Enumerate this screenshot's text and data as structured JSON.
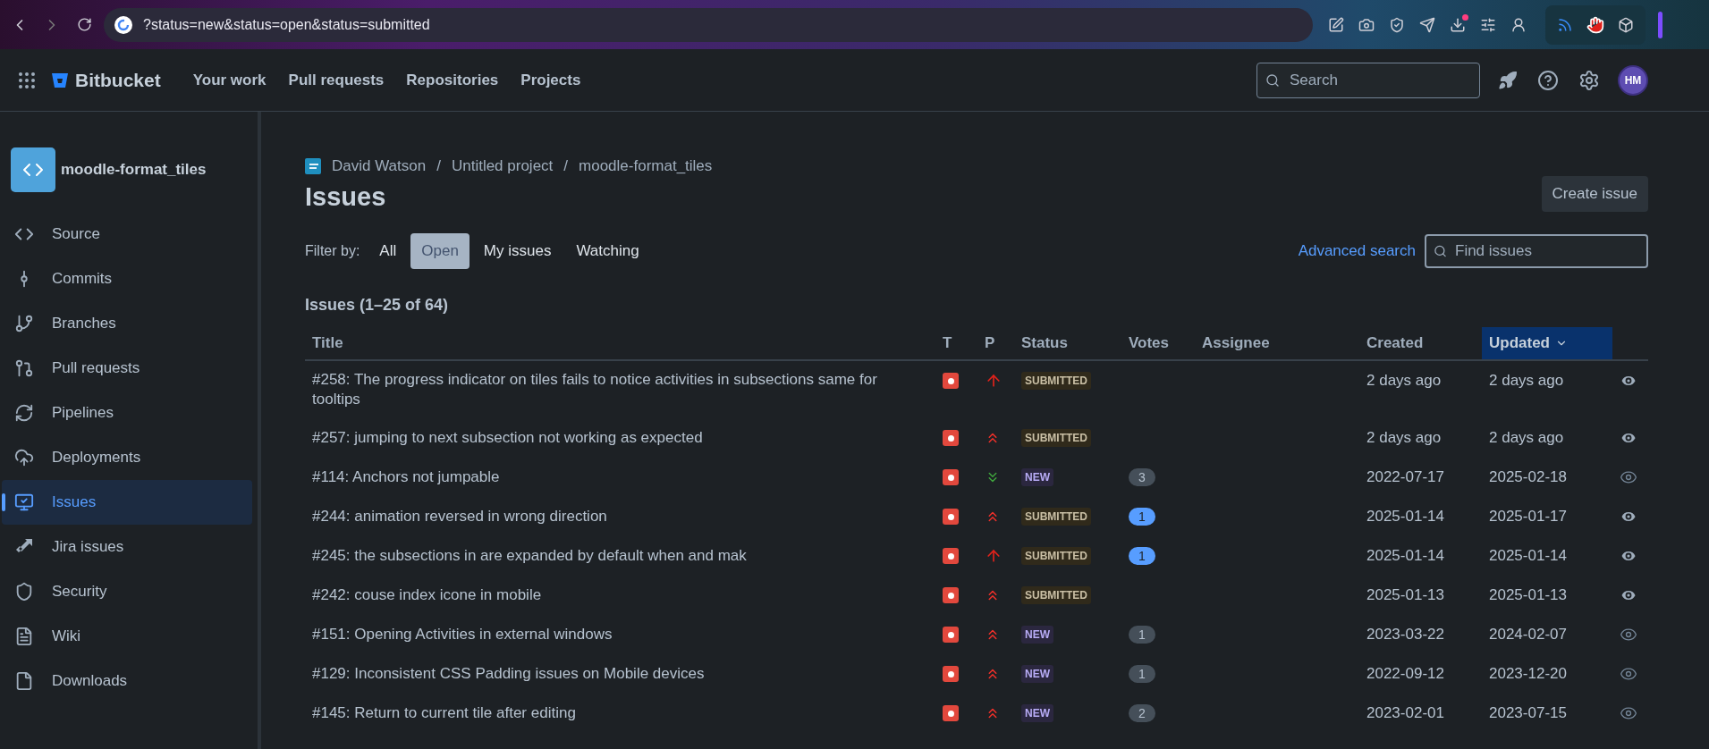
{
  "browser": {
    "url": "?status=new&status=open&status=submitted"
  },
  "nav": {
    "brand": "Bitbucket",
    "links": [
      "Your work",
      "Pull requests",
      "Repositories",
      "Projects"
    ],
    "search": {
      "placeholder": "Search"
    },
    "avatar": "HM"
  },
  "sidebar": {
    "repo": "moodle-format_tiles",
    "items": [
      {
        "label": "Source",
        "selected": false
      },
      {
        "label": "Commits",
        "selected": false
      },
      {
        "label": "Branches",
        "selected": false
      },
      {
        "label": "Pull requests",
        "selected": false
      },
      {
        "label": "Pipelines",
        "selected": false
      },
      {
        "label": "Deployments",
        "selected": false
      },
      {
        "label": "Issues",
        "selected": true
      },
      {
        "label": "Jira issues",
        "selected": false
      },
      {
        "label": "Security",
        "selected": false
      },
      {
        "label": "Wiki",
        "selected": false
      },
      {
        "label": "Downloads",
        "selected": false
      }
    ]
  },
  "breadcrumbs": {
    "items": [
      "David Watson",
      "Untitled project",
      "moodle-format_tiles"
    ],
    "separators": [
      "/",
      "/"
    ]
  },
  "title": "Issues",
  "create_button": "Create issue",
  "filter": {
    "label": "Filter by:",
    "options": [
      {
        "label": "All",
        "selected": false
      },
      {
        "label": "Open",
        "selected": true
      },
      {
        "label": "My issues",
        "selected": false
      },
      {
        "label": "Watching",
        "selected": false
      }
    ],
    "advanced": "Advanced search",
    "find": {
      "placeholder": "Find issues"
    }
  },
  "count": "Issues (1–25 of 64)",
  "table": {
    "columns": [
      {
        "label": "Title",
        "sorted": false
      },
      {
        "label": "T",
        "sorted": false
      },
      {
        "label": "P",
        "sorted": false
      },
      {
        "label": "Status",
        "sorted": false
      },
      {
        "label": "Votes",
        "sorted": false
      },
      {
        "label": "Assignee",
        "sorted": false
      },
      {
        "label": "Created",
        "sorted": false
      },
      {
        "label": "Updated",
        "sorted": true
      }
    ],
    "rows": [
      {
        "title": "#258: The progress indicator on tiles fails to notice activities in subsections same for tooltips",
        "priority": {
          "kind": "critical"
        },
        "status": {
          "label": "SUBMITTED",
          "kind": "submitted"
        },
        "created": "2 days ago",
        "updated": "2 days ago",
        "watching": true
      },
      {
        "title": "#257: jumping to next subsection not working as expected",
        "priority": {
          "kind": "major"
        },
        "status": {
          "label": "SUBMITTED",
          "kind": "submitted"
        },
        "created": "2 days ago",
        "updated": "2 days ago",
        "watching": true
      },
      {
        "title": "#114: Anchors not jumpable",
        "priority": {
          "kind": "trivial"
        },
        "status": {
          "label": "NEW",
          "kind": "new"
        },
        "votes": "3",
        "voted": false,
        "created": "2022-07-17",
        "updated": "2025-02-18",
        "watching": false
      },
      {
        "title": "#244: animation reversed in wrong direction",
        "priority": {
          "kind": "major"
        },
        "status": {
          "label": "SUBMITTED",
          "kind": "submitted"
        },
        "votes": "1",
        "voted": true,
        "created": "2025-01-14",
        "updated": "2025-01-17",
        "watching": true
      },
      {
        "title": "#245: the subsections in are expanded by default when and mak",
        "priority": {
          "kind": "critical"
        },
        "status": {
          "label": "SUBMITTED",
          "kind": "submitted"
        },
        "votes": "1",
        "voted": true,
        "created": "2025-01-14",
        "updated": "2025-01-14",
        "watching": true
      },
      {
        "title": "#242: couse index icone in mobile",
        "priority": {
          "kind": "major"
        },
        "status": {
          "label": "SUBMITTED",
          "kind": "submitted"
        },
        "created": "2025-01-13",
        "updated": "2025-01-13",
        "watching": true
      },
      {
        "title": "#151: Opening Activities in external windows",
        "priority": {
          "kind": "major"
        },
        "status": {
          "label": "NEW",
          "kind": "new"
        },
        "votes": "1",
        "voted": false,
        "created": "2023-03-22",
        "updated": "2024-02-07",
        "watching": false
      },
      {
        "title": "#129: Inconsistent CSS Padding issues on Mobile devices",
        "priority": {
          "kind": "major"
        },
        "status": {
          "label": "NEW",
          "kind": "new"
        },
        "votes": "1",
        "voted": false,
        "created": "2022-09-12",
        "updated": "2023-12-20",
        "watching": false
      },
      {
        "title": "#145: Return to current tile after editing",
        "priority": {
          "kind": "major"
        },
        "status": {
          "label": "NEW",
          "kind": "new"
        },
        "votes": "2",
        "voted": false,
        "created": "2023-02-01",
        "updated": "2023-07-15",
        "watching": false
      }
    ]
  }
}
